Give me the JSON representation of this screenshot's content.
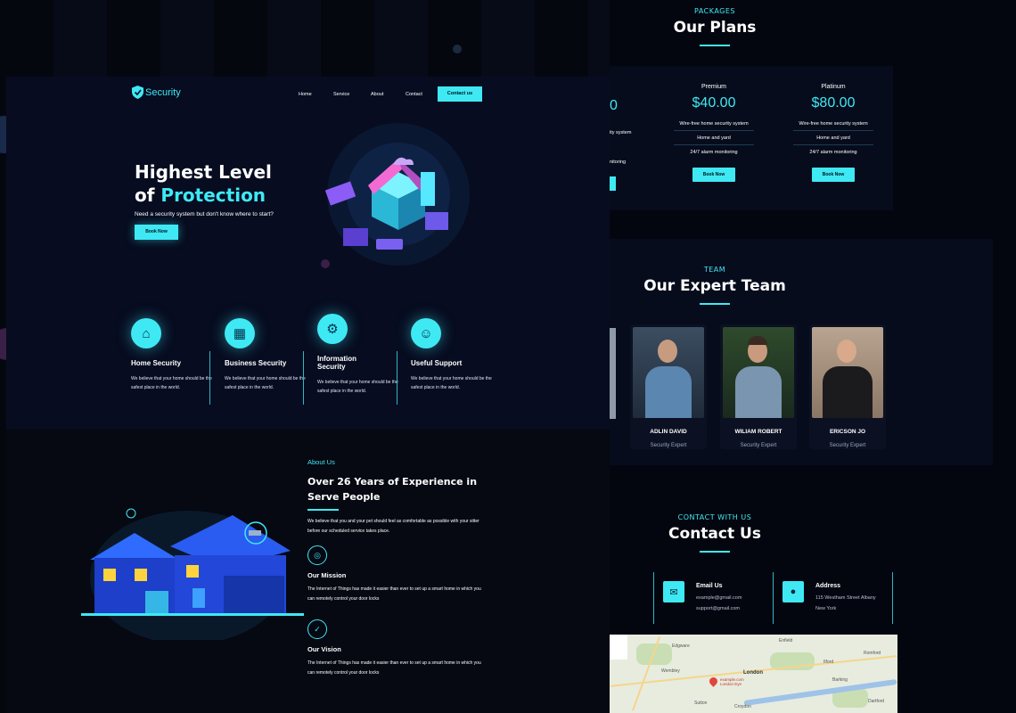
{
  "brand": {
    "name": "Security",
    "accent": "#3ee9f4",
    "background": "#04060f"
  },
  "nav": {
    "items": [
      "Home",
      "Service",
      "About",
      "Contact"
    ],
    "cta": "Contact us"
  },
  "hero": {
    "title_line1": "Highest Level",
    "title_line2_prefix": "of ",
    "title_line2_accent": "Protection",
    "subtitle": "Need a security system but don't know where to start?",
    "button": "Book Now"
  },
  "features": [
    {
      "icon": "home-lock-icon",
      "title": "Home Security",
      "text": "We believe that your home should be the safest place in the world."
    },
    {
      "icon": "building-lock-icon",
      "title": "Business Security",
      "text": "We believe that your home should be the safest place in the world."
    },
    {
      "icon": "gear-lock-icon",
      "title": "Information Security",
      "text": "We believe that your home should be the safest place in the world."
    },
    {
      "icon": "support-agent-icon",
      "title": "Useful Support",
      "text": "We believe that your home should be the safest place in the world."
    }
  ],
  "about": {
    "label": "About Us",
    "title_line1": "Over 26 Years of Experience in",
    "title_line2": "Serve People",
    "text": "We believe that you and your pet should feel as comfortable as possible with your sitter before our scheduled service takes place.",
    "mission_title": "Our Mission",
    "mission_text": "The Internet of Things has made it easier than ever to set up a smart home in which you can remotely control your door locks",
    "vision_title": "Our Vision",
    "vision_text": "The Internet of Things has made it easier than ever to set up a smart home in which you can remotely control your door locks"
  },
  "packages": {
    "label": "PACKAGES",
    "title": "Our Plans",
    "partial_price": "0",
    "partial_features": [
      "ity system",
      "",
      "nitoring"
    ],
    "plans": [
      {
        "name": "Premium",
        "price": "$40.00",
        "features": [
          "Wire-free home security system",
          "Home and yard",
          "24/7 alarm monitoring"
        ],
        "button": "Book Now"
      },
      {
        "name": "Platinum",
        "price": "$80.00",
        "features": [
          "Wire-free home security system",
          "Home and yard",
          "24/7 alarm monitoring"
        ],
        "button": "Book Now"
      }
    ]
  },
  "team": {
    "label": "TEAM",
    "title": "Our Expert Team",
    "members": [
      {
        "name": "ADLIN DAVID",
        "role": "Security Expert"
      },
      {
        "name": "WILIAM ROBERT",
        "role": "Security Expert"
      },
      {
        "name": "ERICSON JO",
        "role": "Security Expert"
      }
    ]
  },
  "contact": {
    "label": "CONTACT WITH US",
    "title": "Contact Us",
    "email_title": "Email Us",
    "email_lines": [
      "example@gmail.com",
      "support@gmail.com"
    ],
    "address_title": "Address",
    "address_lines": [
      "115 Westham Street Albany",
      "New York"
    ]
  },
  "map": {
    "places": [
      "Edgware",
      "Enfield",
      "Wembley",
      "Ilford",
      "Romford",
      "Barking",
      "London",
      "Croydon",
      "Sutton",
      "Dartford"
    ],
    "pin_label": "example.com London Eye"
  }
}
